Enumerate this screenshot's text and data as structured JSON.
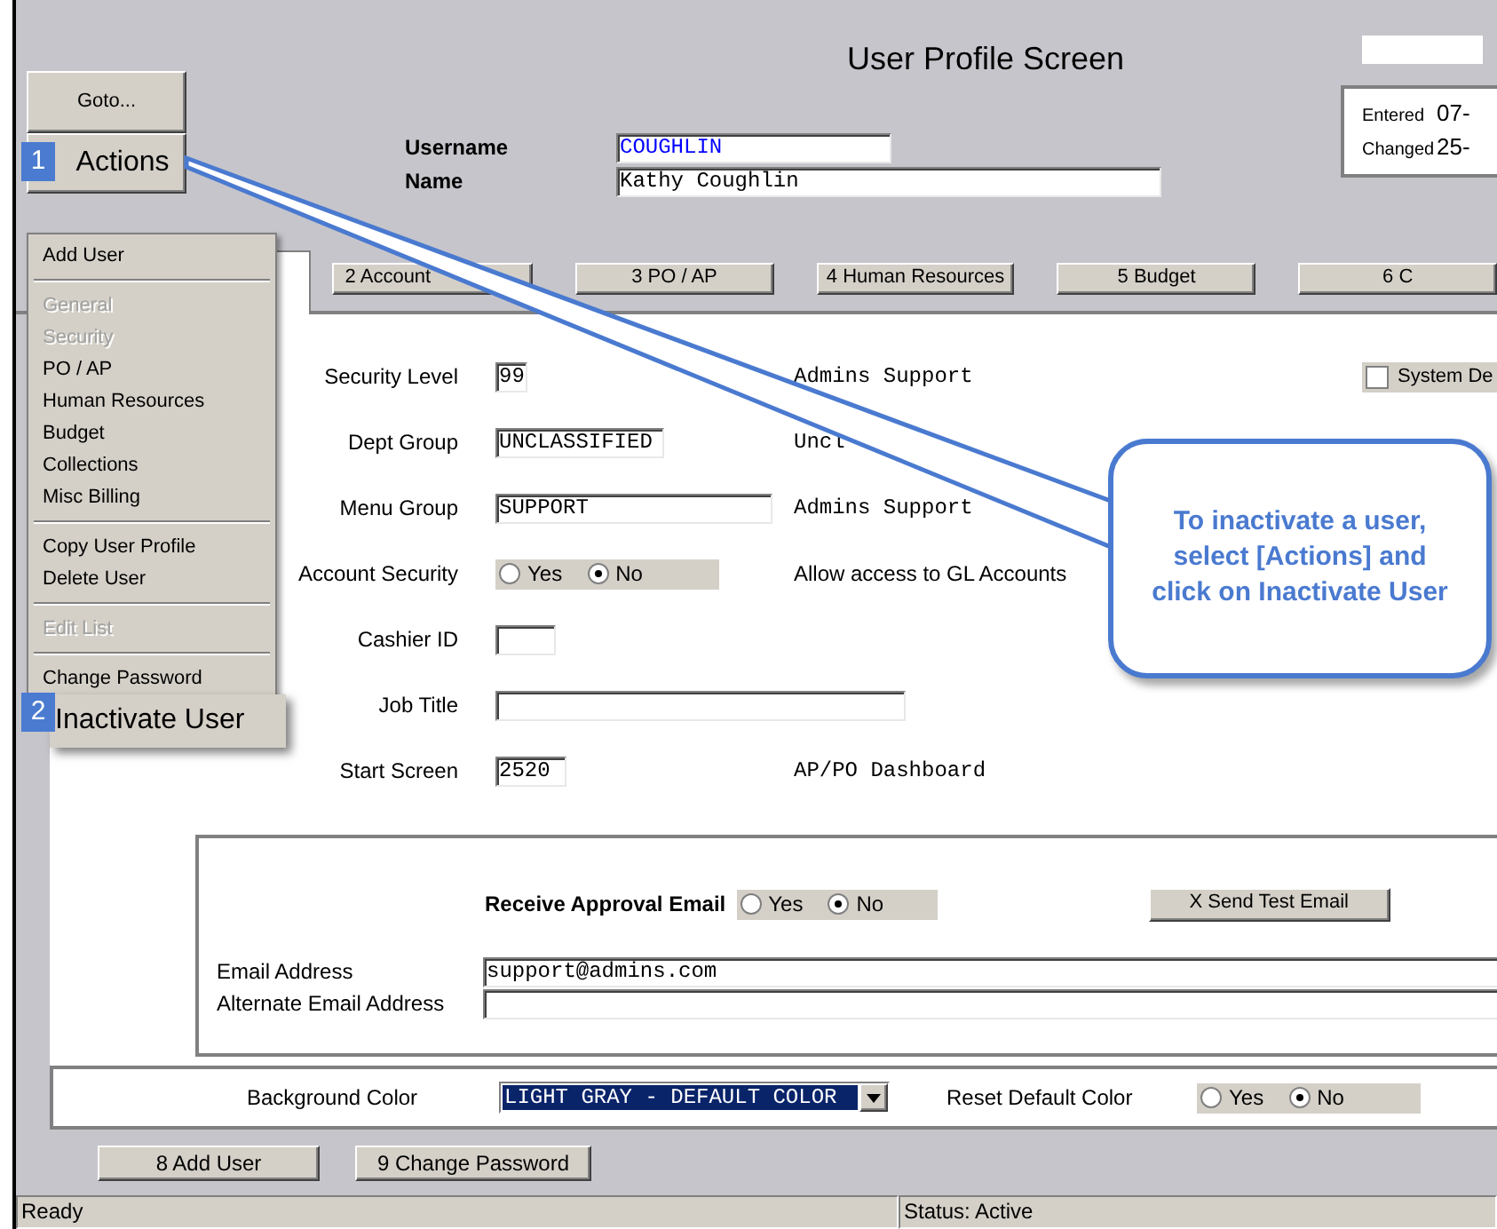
{
  "window": {
    "title": "User Profile Screen"
  },
  "toolbar": [
    {
      "label": "Goto..."
    },
    {
      "label": "Actions",
      "step": "1"
    }
  ],
  "header_fields": [
    {
      "label": "Username",
      "value": "COUGHLIN",
      "kind": "key"
    },
    {
      "label": "Name",
      "value": "Kathy Coughlin",
      "kind": "plain"
    }
  ],
  "audit": [
    {
      "label": "Entered",
      "value": "07-"
    },
    {
      "label": "Changed",
      "value": "25-"
    }
  ],
  "tabs": [
    {
      "selected": true
    },
    {
      "label": "2 Account",
      "selected": false
    },
    {
      "label": "3 PO / AP",
      "selected": false
    },
    {
      "label": "4 Human Resources",
      "selected": false
    },
    {
      "label": "5 Budget",
      "selected": false
    },
    {
      "label": "6 C",
      "selected": false
    }
  ],
  "form": {
    "rows": [
      {
        "kind": "field",
        "label": "Security Level",
        "value": "99",
        "note": "Admins Support"
      },
      {
        "kind": "field",
        "label": "Dept Group",
        "value": "UNCLASSIFIED",
        "note": "Uncl"
      },
      {
        "kind": "field",
        "label": "Menu Group",
        "value": "SUPPORT",
        "note": "Admins Support"
      },
      {
        "kind": "radio",
        "label": "Account Security",
        "options": [
          {
            "label": "Yes",
            "selected": false
          },
          {
            "label": "No",
            "selected": true
          }
        ],
        "note": "Allow access to GL Accounts"
      },
      {
        "kind": "field",
        "label": "Cashier ID"
      },
      {
        "kind": "field",
        "label": "Job Title"
      },
      {
        "kind": "field",
        "label": "Start Screen",
        "value": "2520",
        "note": "AP/PO Dashboard"
      }
    ],
    "system_default": {
      "label": "System De",
      "checked": false
    }
  },
  "email": {
    "receive": {
      "label": "Receive Approval Email",
      "options": [
        {
          "label": "Yes",
          "selected": false
        },
        {
          "label": "No",
          "selected": true
        }
      ]
    },
    "test_button": "X Send Test Email",
    "fields": [
      {
        "label": "Email Address",
        "value": "support@admins.com"
      },
      {
        "label": "Alternate Email Address"
      }
    ]
  },
  "appearance": {
    "background_color": {
      "label": "Background Color",
      "value": "LIGHT GRAY - DEFAULT COLOR"
    },
    "reset": {
      "label": "Reset Default Color",
      "options": [
        {
          "label": "Yes",
          "selected": false
        },
        {
          "label": "No",
          "selected": true
        }
      ]
    }
  },
  "buttons": [
    "8 Add User",
    "9 Change Password"
  ],
  "status_bar": [
    "Ready",
    "Status: Active"
  ],
  "actions_menu": {
    "items": [
      {
        "kind": "item",
        "label": "Add User",
        "disabled": false
      },
      {
        "kind": "separator"
      },
      {
        "kind": "item",
        "label": "General",
        "disabled": true
      },
      {
        "kind": "item",
        "label": "Security",
        "disabled": true
      },
      {
        "kind": "item",
        "label": "PO / AP",
        "disabled": false
      },
      {
        "kind": "item",
        "label": "Human Resources",
        "disabled": false
      },
      {
        "kind": "item",
        "label": "Budget",
        "disabled": false
      },
      {
        "kind": "item",
        "label": "Collections",
        "disabled": false
      },
      {
        "kind": "item",
        "label": "Misc Billing",
        "disabled": false
      },
      {
        "kind": "separator"
      },
      {
        "kind": "item",
        "label": "Copy User Profile",
        "disabled": false
      },
      {
        "kind": "item",
        "label": "Delete User",
        "disabled": false
      },
      {
        "kind": "separator"
      },
      {
        "kind": "item",
        "label": "Edit List",
        "disabled": true
      },
      {
        "kind": "separator"
      },
      {
        "kind": "item",
        "label": "Change Password",
        "disabled": false
      }
    ],
    "highlight": {
      "label": "Inactivate User",
      "step": "2"
    }
  },
  "callout": {
    "lines": [
      "To inactivate a user,",
      "select [Actions] and",
      "click on Inactivate User"
    ]
  }
}
